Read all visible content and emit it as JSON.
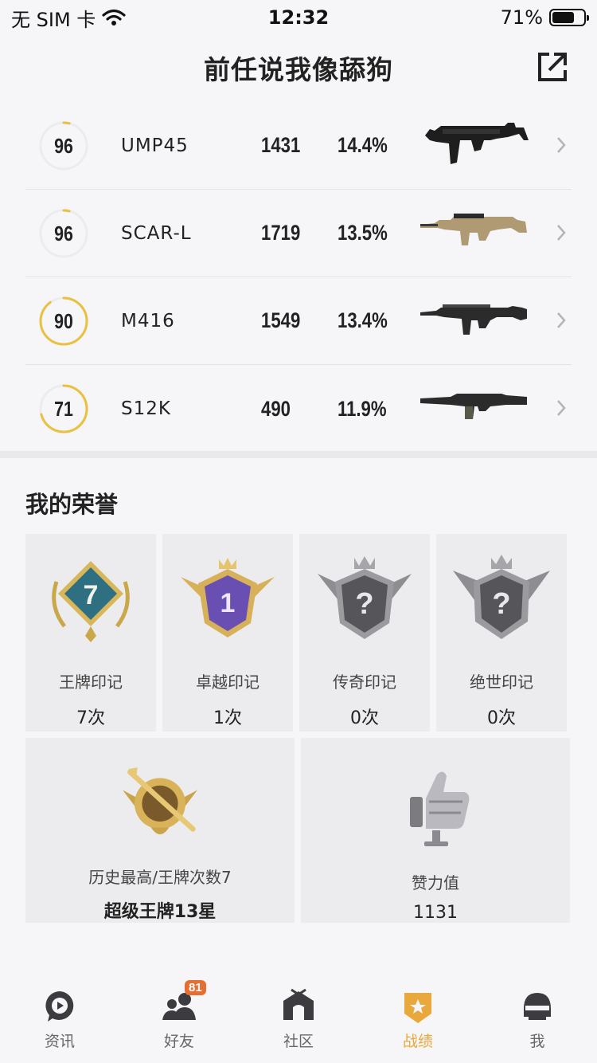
{
  "status_bar": {
    "carrier": "无 SIM 卡",
    "time": "12:32",
    "battery_text": "71%",
    "battery_level": 0.71
  },
  "header": {
    "title": "前任说我像舔狗"
  },
  "weapons": [
    {
      "score": "96",
      "score_fraction": 0.04,
      "name": "UMP45",
      "kills": "1431",
      "rate": "14.4%",
      "ring_color": "#e9c03f"
    },
    {
      "score": "96",
      "score_fraction": 0.04,
      "name": "SCAR-L",
      "kills": "1719",
      "rate": "13.5%",
      "ring_color": "#e9c03f"
    },
    {
      "score": "90",
      "score_fraction": 0.9,
      "name": "M416",
      "kills": "1549",
      "rate": "13.4%",
      "ring_color": "#e9c03f"
    },
    {
      "score": "71",
      "score_fraction": 0.71,
      "name": "S12K",
      "kills": "490",
      "rate": "11.9%",
      "ring_color": "#e9c03f"
    }
  ],
  "honor": {
    "title": "我的荣誉",
    "marks": [
      {
        "label": "王牌印记",
        "count": "7次",
        "badge_text": "7"
      },
      {
        "label": "卓越印记",
        "count": "1次",
        "badge_text": "1"
      },
      {
        "label": "传奇印记",
        "count": "0次",
        "badge_text": "?"
      },
      {
        "label": "绝世印记",
        "count": "0次",
        "badge_text": "?"
      }
    ],
    "history": {
      "label": "历史最高/王牌次数7",
      "value": "超级王牌13星"
    },
    "likes": {
      "label": "赞力值",
      "value": "1131"
    }
  },
  "tabbar": {
    "tabs": [
      {
        "label": "资讯",
        "icon": "play-chat-icon"
      },
      {
        "label": "好友",
        "icon": "friends-icon",
        "badge": "81"
      },
      {
        "label": "社区",
        "icon": "community-house-icon"
      },
      {
        "label": "战绩",
        "icon": "medal-icon",
        "active": true
      },
      {
        "label": "我",
        "icon": "helmet-icon"
      }
    ]
  },
  "colors": {
    "accent": "#e9a83b",
    "ring_track": "#ececee",
    "badge": "#e56f33"
  }
}
